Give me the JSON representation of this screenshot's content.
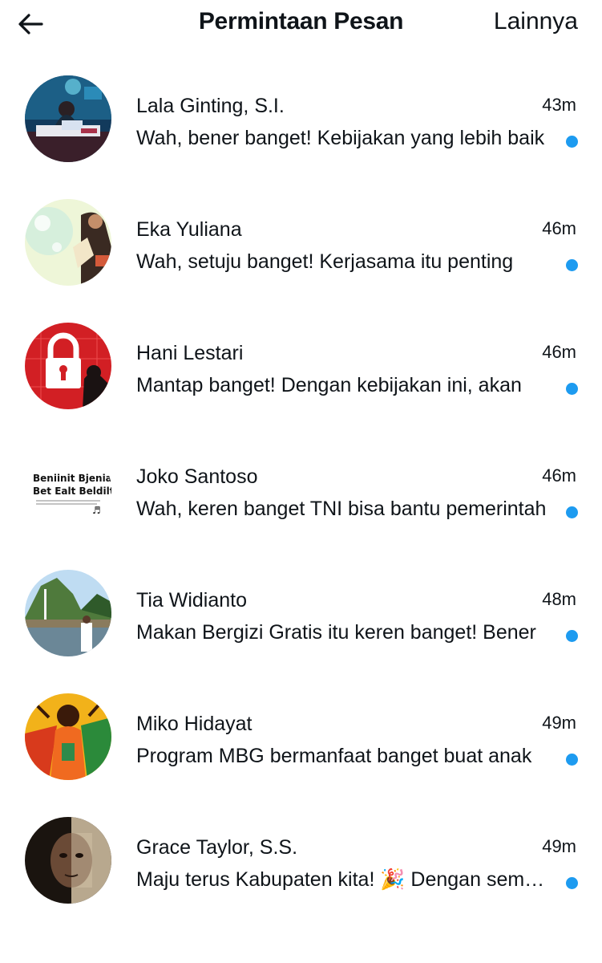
{
  "header": {
    "title": "Permintaan Pesan",
    "more_label": "Lainnya",
    "back_icon": "arrow-left-icon"
  },
  "accent_color": "#1d9bf0",
  "requests": [
    {
      "name": "Lala Ginting, S.I.",
      "time": "43m",
      "preview": "Wah, bener banget! Kebijakan yang lebih baik",
      "unread": true
    },
    {
      "name": "Eka Yuliana",
      "time": "46m",
      "preview": "Wah, setuju banget! Kerjasama itu penting",
      "unread": true
    },
    {
      "name": "Hani Lestari",
      "time": "46m",
      "preview": "Mantap banget! Dengan kebijakan ini, akan",
      "unread": true
    },
    {
      "name": "Joko Santoso",
      "time": "46m",
      "preview": "Wah, keren banget TNI bisa bantu pemerintah",
      "unread": true,
      "avatar_text_1": "Beniinit Bjenia?",
      "avatar_text_2": "Bet Ealt Beldilt"
    },
    {
      "name": "Tia Widianto",
      "time": "48m",
      "preview": "Makan Bergizi Gratis itu keren banget! Bener",
      "unread": true
    },
    {
      "name": "Miko Hidayat",
      "time": "49m",
      "preview": "Program MBG bermanfaat banget buat anak",
      "unread": true
    },
    {
      "name": "Grace Taylor, S.S.",
      "time": "49m",
      "preview": "Maju terus Kabupaten kita! 🎉 Dengan semangat",
      "unread": true
    }
  ]
}
